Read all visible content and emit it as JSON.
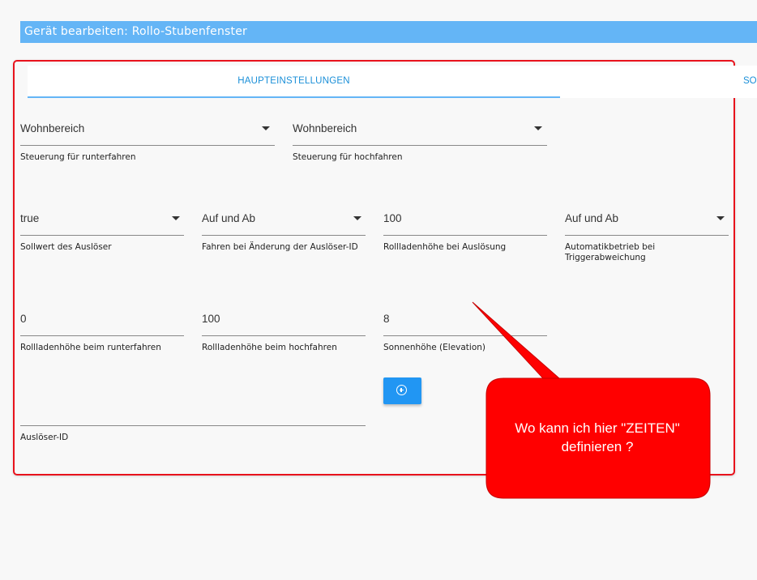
{
  "header": {
    "title": "Gerät bearbeiten: Rollo-Stubenfenster"
  },
  "tabs": [
    {
      "label": "HAUPTEINSTELLUNGEN",
      "active": true
    },
    {
      "label": "SO",
      "active": false
    }
  ],
  "fields": {
    "down_control": {
      "value": "Wohnbereich",
      "label": "Steuerung für runterfahren"
    },
    "up_control": {
      "value": "Wohnbereich",
      "label": "Steuerung für hochfahren"
    },
    "trigger_setpoint": {
      "value": "true",
      "label": "Sollwert des Auslöser"
    },
    "drive_on_change": {
      "value": "Auf und Ab",
      "label": "Fahren bei Änderung der Auslöser-ID"
    },
    "trigger_height": {
      "value": "100",
      "label": "Rollladenhöhe bei Auslösung"
    },
    "auto_mode": {
      "value": "Auf und Ab",
      "label": "Automatikbetrieb bei Triggerabweichung"
    },
    "down_height": {
      "value": "0",
      "label": "Rollladenhöhe beim runterfahren"
    },
    "up_height": {
      "value": "100",
      "label": "Rollladenhöhe beim hochfahren"
    },
    "elevation": {
      "value": "8",
      "label": "Sonnenhöhe (Elevation)"
    },
    "trigger_id": {
      "value": "",
      "label": "Auslöser-ID"
    }
  },
  "add_button": {
    "icon": "add-circle-icon"
  },
  "callout": {
    "text": "Wo kann ich hier \"ZEITEN\" definieren ?",
    "color": "#ff0000"
  },
  "colors": {
    "accent": "#64b5f6",
    "tab_text": "#1a8fd8",
    "button": "#2196f3",
    "highlight_frame": "#e8121c"
  }
}
